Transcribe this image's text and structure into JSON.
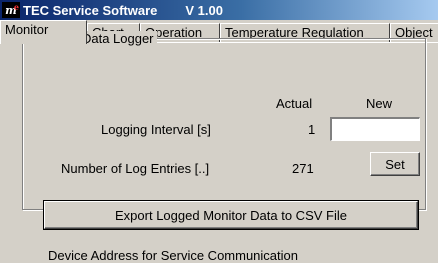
{
  "window": {
    "icon_text": "m",
    "icon_sup": "e",
    "title": "TEC Service Software",
    "version": "V 1.00"
  },
  "tabs": [
    {
      "label": "Monitor"
    },
    {
      "label": "Chart"
    },
    {
      "label": "Operation"
    },
    {
      "label": "Temperature Regulation"
    },
    {
      "label": "Object"
    }
  ],
  "data_logger": {
    "group_title": "Monitor Data Logger",
    "col_actual": "Actual",
    "col_new": "New",
    "logging_interval_label": "Logging Interval [s]",
    "logging_interval_actual": "1",
    "logging_interval_new": "",
    "log_entries_label": "Number of Log Entries [..]",
    "log_entries_actual": "271",
    "set_button": "Set",
    "export_button": "Export Logged Monitor Data to CSV File"
  },
  "next_group": {
    "partial_title": "Device Address for Service Communication"
  }
}
